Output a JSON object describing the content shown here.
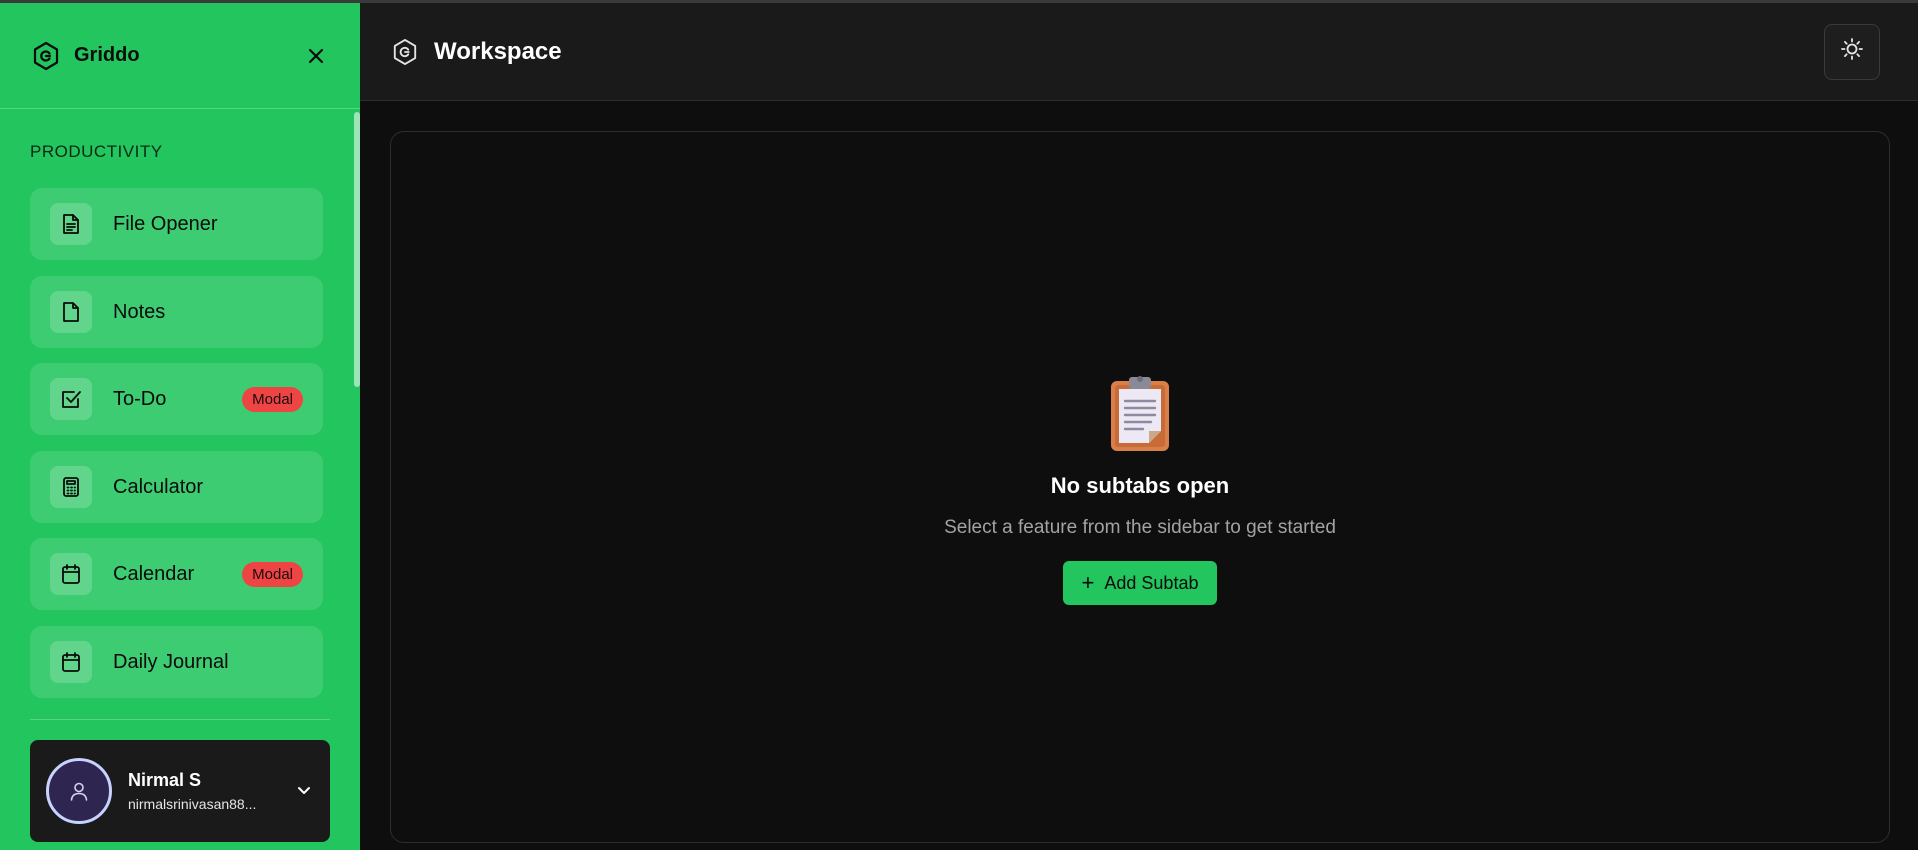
{
  "app": {
    "brand": "Griddo"
  },
  "sidebar": {
    "section_title": "PRODUCTIVITY",
    "items": [
      {
        "label": "File Opener",
        "icon": "file-text-icon",
        "badge": ""
      },
      {
        "label": "Notes",
        "icon": "file-icon",
        "badge": ""
      },
      {
        "label": "To-Do",
        "icon": "checkbox-icon",
        "badge": "Modal"
      },
      {
        "label": "Calculator",
        "icon": "calculator-icon",
        "badge": ""
      },
      {
        "label": "Calendar",
        "icon": "calendar-icon",
        "badge": "Modal"
      },
      {
        "label": "Daily Journal",
        "icon": "calendar-icon",
        "badge": ""
      }
    ],
    "user": {
      "name": "Nirmal S",
      "email": "nirmalsrinivasan88..."
    }
  },
  "header": {
    "title": "Workspace",
    "theme_toggle_icon": "sun-icon"
  },
  "workspace": {
    "empty_title": "No subtabs open",
    "empty_subtitle": "Select a feature from the sidebar to get started",
    "add_button_label": "Add Subtab",
    "empty_icon": "clipboard-icon"
  },
  "colors": {
    "accent": "#22c55e",
    "badge": "#ef4444",
    "background": "#0e0e0e",
    "topbar": "#1a1a1a"
  }
}
